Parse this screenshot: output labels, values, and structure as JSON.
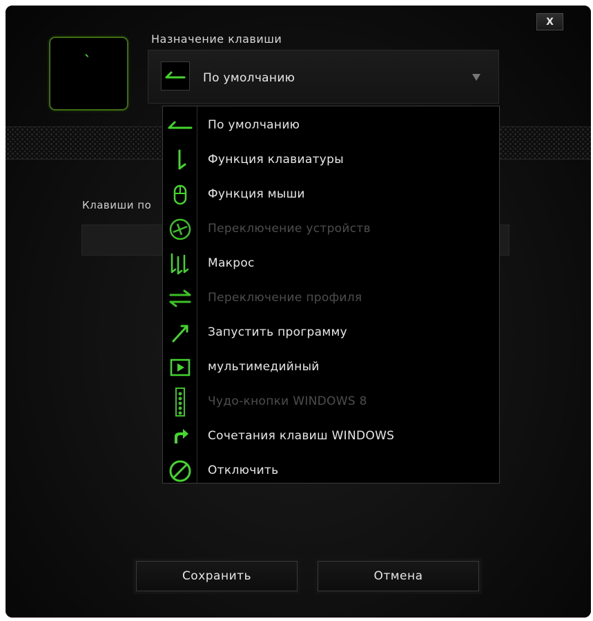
{
  "dialog": {
    "close_label": "X",
    "key_glyph": "`",
    "assignment_label": "Назначение клавиши",
    "selected_value": "По умолчанию",
    "keys_label": "Клавиши по",
    "accent_color": "#44d62c"
  },
  "menu": {
    "items": [
      {
        "label": "По умолчанию",
        "icon": "default-arrow-icon",
        "enabled": true
      },
      {
        "label": "Функция клавиатуры",
        "icon": "keyboard-function-icon",
        "enabled": true
      },
      {
        "label": "Функция мыши",
        "icon": "mouse-icon",
        "enabled": true
      },
      {
        "label": "Переключение устройств",
        "icon": "device-switch-icon",
        "enabled": false
      },
      {
        "label": "Макрос",
        "icon": "macro-icon",
        "enabled": true
      },
      {
        "label": "Переключение профиля",
        "icon": "profile-switch-icon",
        "enabled": false
      },
      {
        "label": "Запустить программу",
        "icon": "launch-program-icon",
        "enabled": true
      },
      {
        "label": "мультимедийный",
        "icon": "multimedia-icon",
        "enabled": true
      },
      {
        "label": "Чудо-кнопки WINDOWS 8",
        "icon": "charms-icon",
        "enabled": false
      },
      {
        "label": "Сочетания клавиш WINDOWS",
        "icon": "windows-shortcut-icon",
        "enabled": true
      },
      {
        "label": "Отключить",
        "icon": "disable-icon",
        "enabled": true
      }
    ]
  },
  "buttons": {
    "save_label": "Сохранить",
    "cancel_label": "Отмена"
  }
}
